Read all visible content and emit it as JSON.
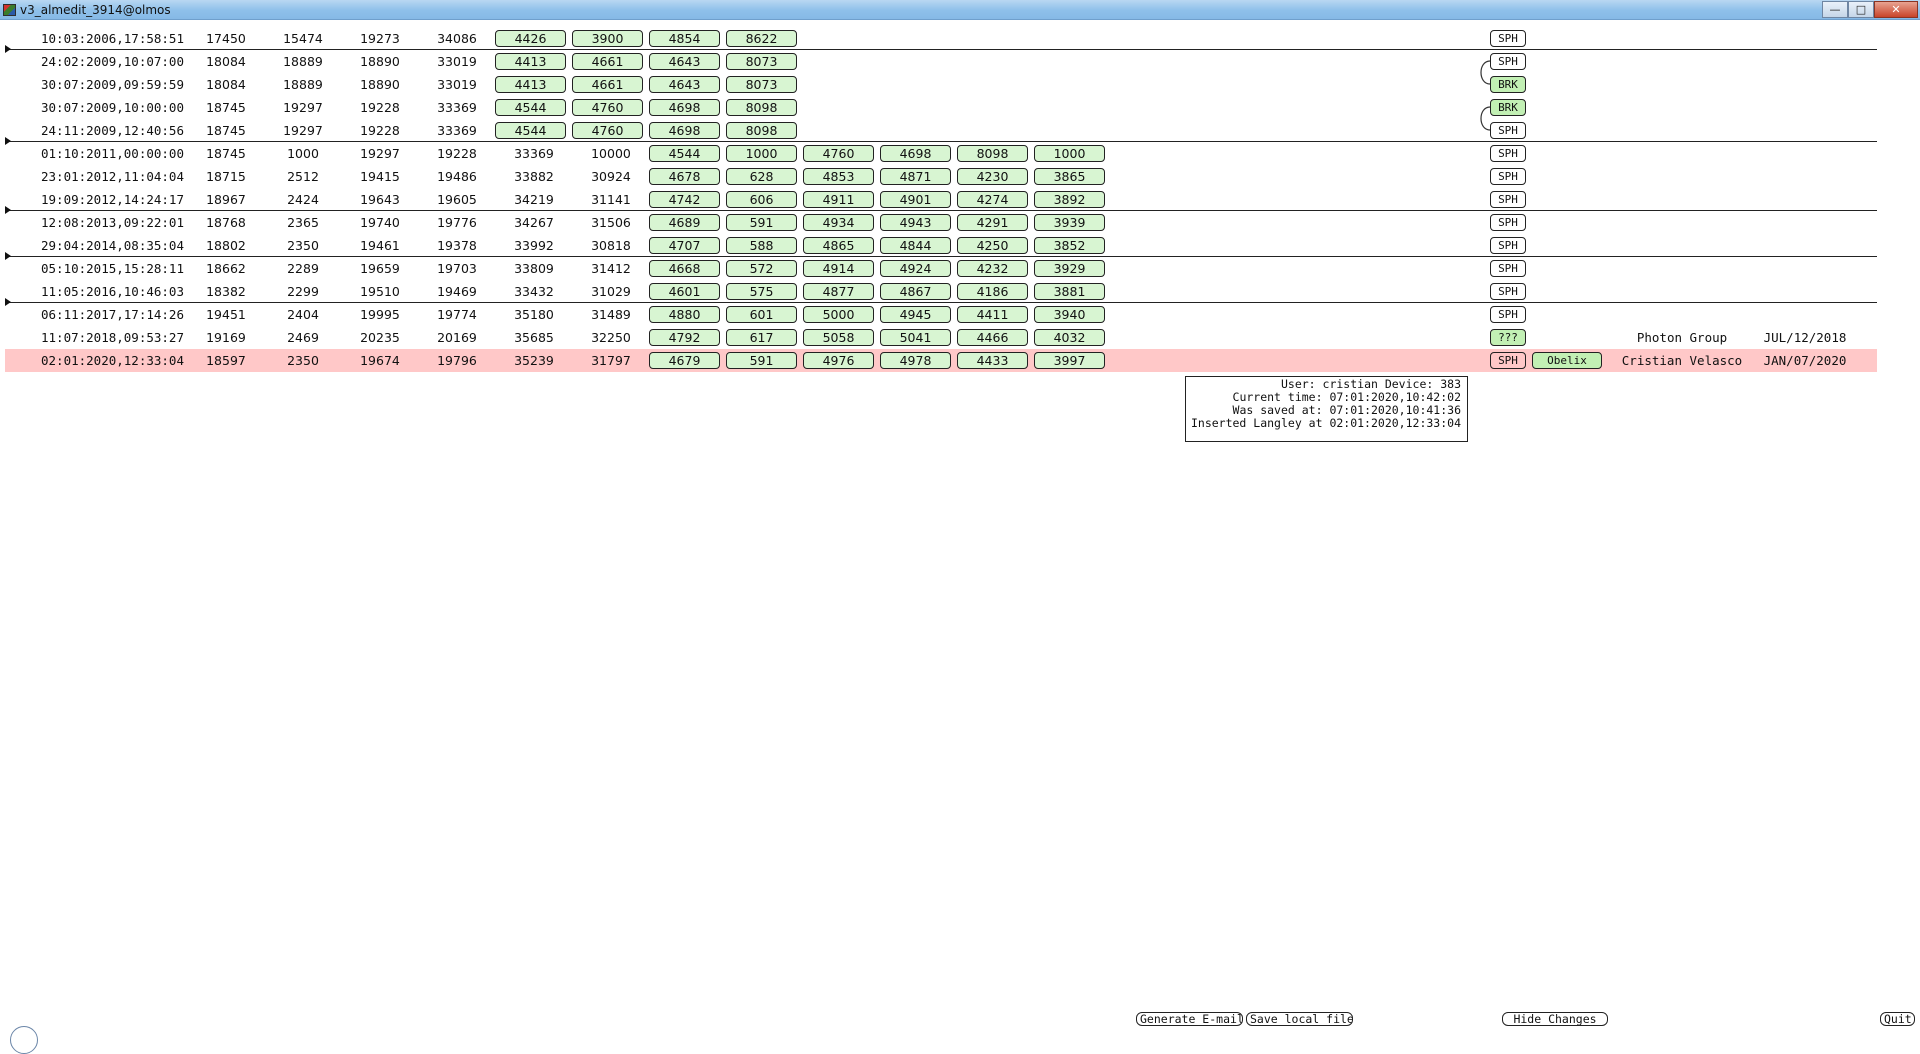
{
  "window": {
    "title": "v3_almedit_3914@olmos",
    "min": "—",
    "max": "□",
    "close": "✕"
  },
  "rows": [
    {
      "date": "10:03:2006,17:58:51",
      "plain": [
        "17450",
        "15474",
        "19273",
        "34086"
      ],
      "pills": [
        "4426",
        "3900",
        "4854",
        "8622"
      ],
      "status": "SPH",
      "status_style": "white",
      "sep_before": false
    },
    {
      "date": "24:02:2009,10:07:00",
      "plain": [
        "18084",
        "18889",
        "18890",
        "33019"
      ],
      "pills": [
        "4413",
        "4661",
        "4643",
        "8073"
      ],
      "status": "SPH",
      "status_style": "white",
      "sep_before": true
    },
    {
      "date": "30:07:2009,09:59:59",
      "plain": [
        "18084",
        "18889",
        "18890",
        "33019"
      ],
      "pills": [
        "4413",
        "4661",
        "4643",
        "8073"
      ],
      "status": "BRK",
      "status_style": "green",
      "sep_before": false
    },
    {
      "date": "30:07:2009,10:00:00",
      "plain": [
        "18745",
        "19297",
        "19228",
        "33369"
      ],
      "pills": [
        "4544",
        "4760",
        "4698",
        "8098"
      ],
      "status": "BRK",
      "status_style": "green",
      "sep_before": false
    },
    {
      "date": "24:11:2009,12:40:56",
      "plain": [
        "18745",
        "19297",
        "19228",
        "33369"
      ],
      "pills": [
        "4544",
        "4760",
        "4698",
        "8098"
      ],
      "status": "SPH",
      "status_style": "white",
      "sep_before": false
    },
    {
      "date": "01:10:2011,00:00:00",
      "plain": [
        "18745",
        "1000",
        "19297",
        "19228",
        "33369",
        "10000"
      ],
      "pills": [
        "4544",
        "1000",
        "4760",
        "4698",
        "8098",
        "1000"
      ],
      "status": "SPH",
      "status_style": "white",
      "sep_before": true
    },
    {
      "date": "23:01:2012,11:04:04",
      "plain": [
        "18715",
        "2512",
        "19415",
        "19486",
        "33882",
        "30924"
      ],
      "pills": [
        "4678",
        "628",
        "4853",
        "4871",
        "4230",
        "3865"
      ],
      "status": "SPH",
      "status_style": "white",
      "sep_before": false
    },
    {
      "date": "19:09:2012,14:24:17",
      "plain": [
        "18967",
        "2424",
        "19643",
        "19605",
        "34219",
        "31141"
      ],
      "pills": [
        "4742",
        "606",
        "4911",
        "4901",
        "4274",
        "3892"
      ],
      "status": "SPH",
      "status_style": "white",
      "sep_before": false
    },
    {
      "date": "12:08:2013,09:22:01",
      "plain": [
        "18768",
        "2365",
        "19740",
        "19776",
        "34267",
        "31506"
      ],
      "pills": [
        "4689",
        "591",
        "4934",
        "4943",
        "4291",
        "3939"
      ],
      "status": "SPH",
      "status_style": "white",
      "sep_before": true
    },
    {
      "date": "29:04:2014,08:35:04",
      "plain": [
        "18802",
        "2350",
        "19461",
        "19378",
        "33992",
        "30818"
      ],
      "pills": [
        "4707",
        "588",
        "4865",
        "4844",
        "4250",
        "3852"
      ],
      "status": "SPH",
      "status_style": "white",
      "sep_before": false
    },
    {
      "date": "05:10:2015,15:28:11",
      "plain": [
        "18662",
        "2289",
        "19659",
        "19703",
        "33809",
        "31412"
      ],
      "pills": [
        "4668",
        "572",
        "4914",
        "4924",
        "4232",
        "3929"
      ],
      "status": "SPH",
      "status_style": "white",
      "sep_before": true
    },
    {
      "date": "11:05:2016,10:46:03",
      "plain": [
        "18382",
        "2299",
        "19510",
        "19469",
        "33432",
        "31029"
      ],
      "pills": [
        "4601",
        "575",
        "4877",
        "4867",
        "4186",
        "3881"
      ],
      "status": "SPH",
      "status_style": "white",
      "sep_before": false
    },
    {
      "date": "06:11:2017,17:14:26",
      "plain": [
        "19451",
        "2404",
        "19995",
        "19774",
        "35180",
        "31489"
      ],
      "pills": [
        "4880",
        "601",
        "5000",
        "4945",
        "4411",
        "3940"
      ],
      "status": "SPH",
      "status_style": "white",
      "sep_before": true
    },
    {
      "date": "11:07:2018,09:53:27",
      "plain": [
        "19169",
        "2469",
        "20235",
        "20169",
        "35685",
        "32250"
      ],
      "pills": [
        "4792",
        "617",
        "5058",
        "5041",
        "4466",
        "4032"
      ],
      "status": "???",
      "status_style": "green",
      "sep_before": false,
      "group": "Photon Group",
      "group_date": "JUL/12/2018"
    },
    {
      "date": "02:01:2020,12:33:04",
      "plain": [
        "18597",
        "2350",
        "19674",
        "19796",
        "35239",
        "31797"
      ],
      "pills": [
        "4679",
        "591",
        "4976",
        "4978",
        "4433",
        "3997"
      ],
      "status": "SPH",
      "status_style": "pink",
      "sep_before": false,
      "current": true,
      "device": "Obelix",
      "user_name": "Cristian Velasco",
      "group_date": "JAN/07/2020"
    }
  ],
  "info": {
    "line1": "User: cristian Device: 383",
    "line2": "Current time: 07:01:2020,10:42:02",
    "line3": "Was saved at: 07:01:2020,10:41:36",
    "line4": "Inserted Langley at 02:01:2020,12:33:04"
  },
  "buttons": {
    "generate_email": "Generate E-mail",
    "save_local": "Save local file",
    "hide_changes": "Hide Changes",
    "quit": "Quit"
  },
  "colors": {
    "pill_green": "#d8f5d2",
    "badge_green": "#c2f0b4",
    "current_row": "#ffc8c8",
    "titlebar": "#8ec0ea"
  }
}
